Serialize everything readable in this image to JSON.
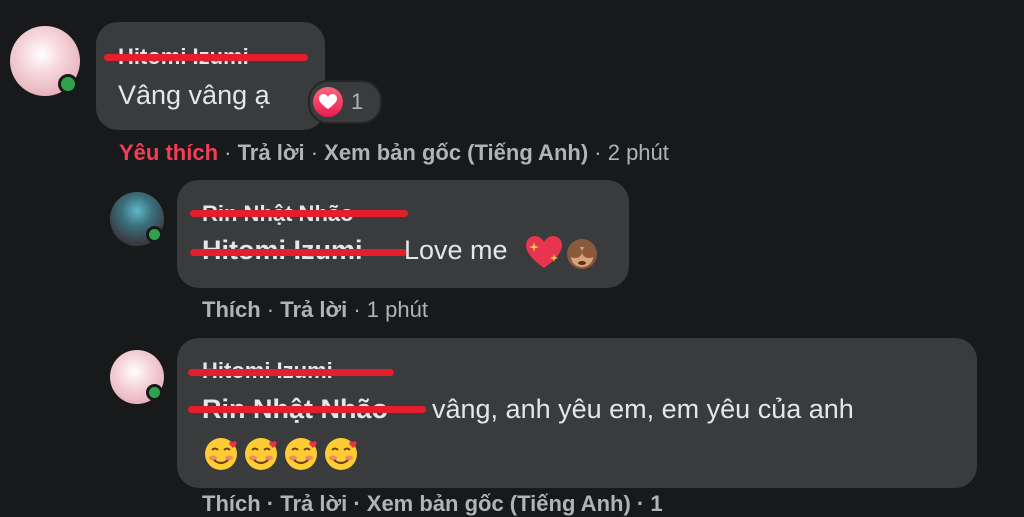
{
  "comments": [
    {
      "author": "Hitomi Izumi",
      "text": "Vâng vâng ạ",
      "reaction_count": "1",
      "actions": {
        "like": "Yêu thích",
        "reply": "Trả lời",
        "see_original": "Xem bản gốc (Tiếng Anh)",
        "time": "2 phút"
      }
    },
    {
      "author": "Rin Nhật Nhão",
      "mention": "Hitomi Izumi",
      "text": "Love me",
      "actions": {
        "like": "Thích",
        "reply": "Trả lời",
        "time": "1 phút"
      }
    },
    {
      "author": "Hitomi Izumi",
      "mention": "Rin Nhật Nhão",
      "text": "vâng, anh yêu em, em yêu của anh",
      "actions": {
        "partial": "Thích · Trả lời · Xem bản gốc (Tiếng Anh) · 1"
      }
    }
  ],
  "icons": {
    "reaction": "heart-reaction-icon",
    "emoji_1": "sparkling-heart-emoji",
    "emoji_2": "see-no-evil-monkey-emoji",
    "emoji_3": "smiling-face-with-hearts-emoji"
  },
  "colors": {
    "background": "#18191a",
    "bubble": "#3a3b3c",
    "liked": "#f33e58",
    "online": "#31a24c",
    "redaction": "#e41e2a"
  }
}
